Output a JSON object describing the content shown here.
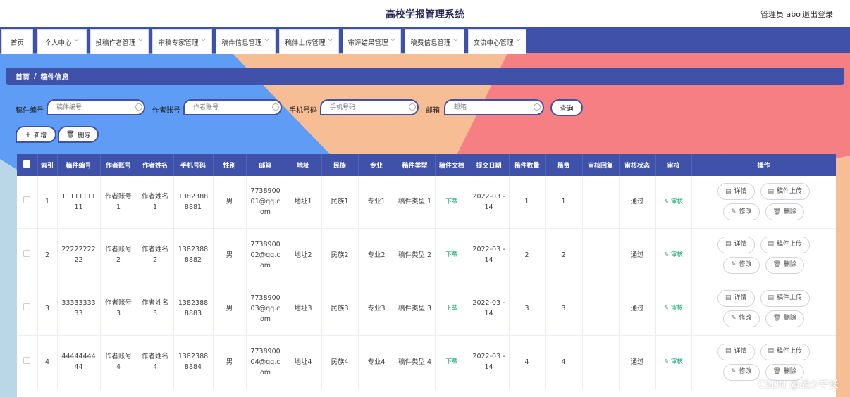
{
  "header": {
    "title": "高校学报管理系统",
    "user": "管理员 abo",
    "logout": "退出登录"
  },
  "nav": [
    {
      "label": "首页",
      "dropdown": false
    },
    {
      "label": "个人中心",
      "dropdown": true
    },
    {
      "label": "投稿作者管理",
      "dropdown": true
    },
    {
      "label": "审稿专家管理",
      "dropdown": true
    },
    {
      "label": "稿件信息管理",
      "dropdown": true
    },
    {
      "label": "稿件上传管理",
      "dropdown": true
    },
    {
      "label": "审评结果管理",
      "dropdown": true
    },
    {
      "label": "稿费信息管理",
      "dropdown": true
    },
    {
      "label": "交流中心管理",
      "dropdown": true
    }
  ],
  "breadcrumb": {
    "home": "首页",
    "separator": "/",
    "current": "稿件信息"
  },
  "search": {
    "fields": [
      {
        "label": "稿件编号",
        "placeholder": "稿件编号"
      },
      {
        "label": "作者账号",
        "placeholder": "作者账号"
      },
      {
        "label": "手机号码",
        "placeholder": "手机号码"
      },
      {
        "label": "邮箱",
        "placeholder": "邮箱"
      }
    ],
    "query": "查询"
  },
  "actions": {
    "add": "新增",
    "delete": "删除"
  },
  "table": {
    "columns": [
      "索引",
      "稿件编号",
      "作者账号",
      "作者姓名",
      "手机号码",
      "性别",
      "邮箱",
      "地址",
      "民族",
      "专业",
      "稿件类型",
      "稿件文档",
      "提交日期",
      "稿件数量",
      "稿费",
      "审核回复",
      "审核状态",
      "审核",
      "操作"
    ],
    "rows": [
      {
        "index": "1",
        "code": "11111111 11",
        "account": "作者账号 1",
        "name": "作者姓名 1",
        "phone": "1382388 8881",
        "gender": "男",
        "email": "7738900 01@qq.c om",
        "address": "地址1",
        "nation": "民族1",
        "major": "专业1",
        "type": "稿件类型 1",
        "doc": "下载",
        "date": "2022-03 -14",
        "count": "1",
        "fee": "1",
        "reply": "",
        "status": "通过",
        "audit": "审核"
      },
      {
        "index": "2",
        "code": "22222222 22",
        "account": "作者账号 2",
        "name": "作者姓名 2",
        "phone": "1382388 8882",
        "gender": "男",
        "email": "7738900 02@qq.c om",
        "address": "地址2",
        "nation": "民族2",
        "major": "专业2",
        "type": "稿件类型 2",
        "doc": "下载",
        "date": "2022-03 -14",
        "count": "2",
        "fee": "2",
        "reply": "",
        "status": "通过",
        "audit": "审核"
      },
      {
        "index": "3",
        "code": "33333333 33",
        "account": "作者账号 3",
        "name": "作者姓名 3",
        "phone": "1382388 8883",
        "gender": "男",
        "email": "7738900 03@qq.c om",
        "address": "地址3",
        "nation": "民族3",
        "major": "专业3",
        "type": "稿件类型 3",
        "doc": "下载",
        "date": "2022-03 -14",
        "count": "3",
        "fee": "3",
        "reply": "",
        "status": "通过",
        "audit": "审核"
      },
      {
        "index": "4",
        "code": "44444444 44",
        "account": "作者账号 4",
        "name": "作者姓名 4",
        "phone": "1382388 8884",
        "gender": "男",
        "email": "7738900 04@qq.c om",
        "address": "地址4",
        "nation": "民族4",
        "major": "专业4",
        "type": "稿件类型 4",
        "doc": "下载",
        "date": "2022-03 -14",
        "count": "4",
        "fee": "4",
        "reply": "",
        "status": "通过",
        "audit": "审核"
      }
    ],
    "ops": {
      "detail": "详情",
      "upload": "稿件上传",
      "edit": "修改",
      "delete": "删除"
    }
  },
  "watermark": "CSDN @战少学长",
  "colors": {
    "primary": "#3f51a8",
    "blue": "#5f9cf5",
    "peach": "#f7bd94",
    "coral": "#f57f82",
    "success": "#1aa57a"
  }
}
